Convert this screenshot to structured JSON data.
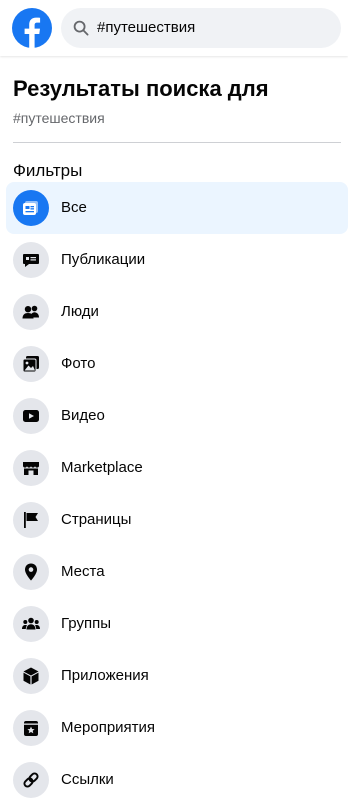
{
  "search": {
    "query": "#путешествия"
  },
  "results": {
    "heading": "Результаты поиска для",
    "query": "#путешествия"
  },
  "filters": {
    "title": "Фильтры",
    "items": [
      {
        "label": "Все",
        "icon": "all-results-icon",
        "active": true
      },
      {
        "label": "Публикации",
        "icon": "posts-icon",
        "active": false
      },
      {
        "label": "Люди",
        "icon": "people-icon",
        "active": false
      },
      {
        "label": "Фото",
        "icon": "photos-icon",
        "active": false
      },
      {
        "label": "Видео",
        "icon": "video-icon",
        "active": false
      },
      {
        "label": "Marketplace",
        "icon": "marketplace-icon",
        "active": false
      },
      {
        "label": "Страницы",
        "icon": "pages-flag-icon",
        "active": false
      },
      {
        "label": "Места",
        "icon": "places-pin-icon",
        "active": false
      },
      {
        "label": "Группы",
        "icon": "groups-icon",
        "active": false
      },
      {
        "label": "Приложения",
        "icon": "apps-cube-icon",
        "active": false
      },
      {
        "label": "Мероприятия",
        "icon": "events-calendar-icon",
        "active": false
      },
      {
        "label": "Ссылки",
        "icon": "links-icon",
        "active": false
      }
    ]
  },
  "colors": {
    "brand": "#1877f2",
    "active_bg": "#ebf5ff",
    "icon_bg": "#e4e6eb",
    "icon_fg": "#050505",
    "secondary_text": "#65676b"
  }
}
